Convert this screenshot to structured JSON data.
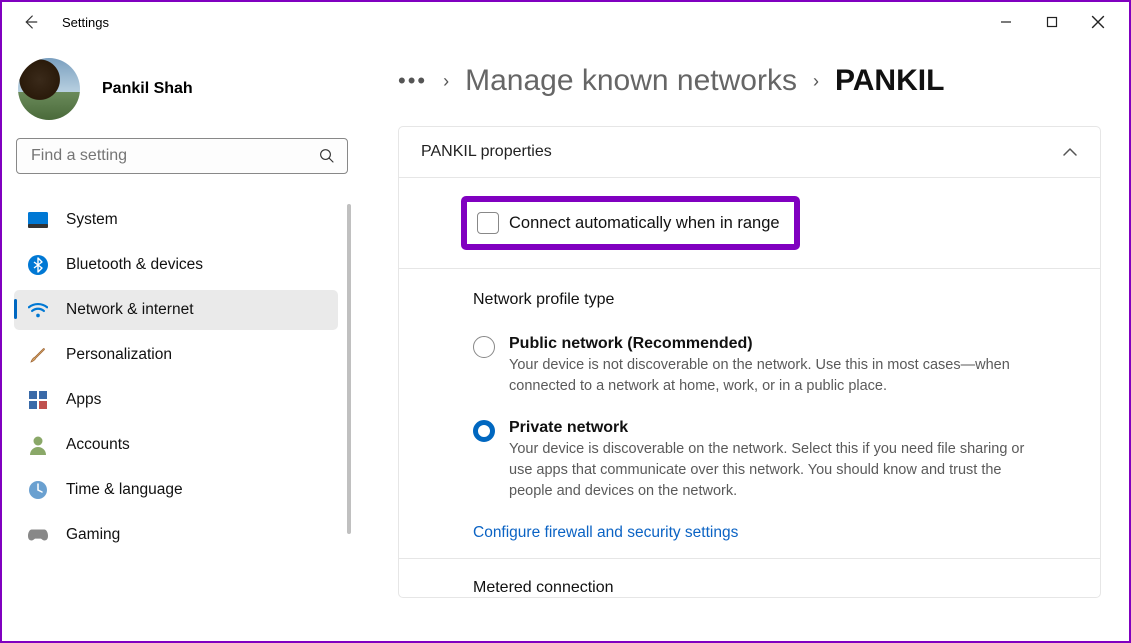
{
  "window": {
    "title": "Settings"
  },
  "profile": {
    "name": "Pankil Shah"
  },
  "search": {
    "placeholder": "Find a setting"
  },
  "nav": {
    "items": [
      {
        "label": "System"
      },
      {
        "label": "Bluetooth & devices"
      },
      {
        "label": "Network & internet"
      },
      {
        "label": "Personalization"
      },
      {
        "label": "Apps"
      },
      {
        "label": "Accounts"
      },
      {
        "label": "Time & language"
      },
      {
        "label": "Gaming"
      }
    ]
  },
  "breadcrumb": {
    "parent": "Manage known networks",
    "current": "PANKIL"
  },
  "panel": {
    "title": "PANKIL properties",
    "auto_connect": "Connect automatically when in range",
    "profile_type_heading": "Network profile type",
    "public": {
      "title": "Public network (Recommended)",
      "desc": "Your device is not discoverable on the network. Use this in most cases—when connected to a network at home, work, or in a public place."
    },
    "private": {
      "title": "Private network",
      "desc": "Your device is discoverable on the network. Select this if you need file sharing or use apps that communicate over this network. You should know and trust the people and devices on the network."
    },
    "firewall_link": "Configure firewall and security settings",
    "metered": "Metered connection"
  }
}
